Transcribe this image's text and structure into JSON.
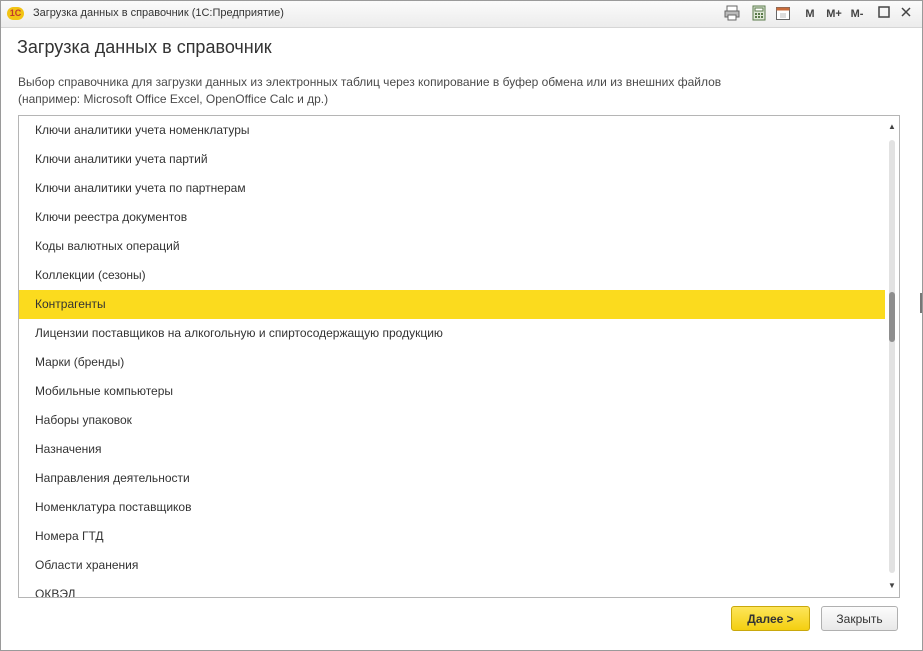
{
  "window": {
    "title": "Загрузка данных в справочник  (1С:Предприятие)",
    "logo": "1С",
    "toolbar": {
      "memory": "M",
      "memory_plus": "M+",
      "memory_minus": "M-"
    }
  },
  "form": {
    "title": "Загрузка данных в справочник",
    "description_line1": "Выбор справочника для загрузки данных из электронных таблиц через копирование в буфер обмена или из внешних файлов",
    "description_line2": "(например: Microsoft Office Excel, OpenOffice Calc и др.)"
  },
  "list": {
    "items": [
      {
        "label": "Ключи аналитики учета номенклатуры",
        "selected": false
      },
      {
        "label": "Ключи аналитики учета партий",
        "selected": false
      },
      {
        "label": "Ключи аналитики учета по партнерам",
        "selected": false
      },
      {
        "label": "Ключи реестра документов",
        "selected": false
      },
      {
        "label": "Коды валютных операций",
        "selected": false
      },
      {
        "label": "Коллекции (сезоны)",
        "selected": false
      },
      {
        "label": "Контрагенты",
        "selected": true
      },
      {
        "label": "Лицензии поставщиков на алкогольную и спиртосодержащую продукцию",
        "selected": false
      },
      {
        "label": "Марки (бренды)",
        "selected": false
      },
      {
        "label": "Мобильные компьютеры",
        "selected": false
      },
      {
        "label": "Наборы упаковок",
        "selected": false
      },
      {
        "label": "Назначения",
        "selected": false
      },
      {
        "label": "Направления деятельности",
        "selected": false
      },
      {
        "label": "Номенклатура поставщиков",
        "selected": false
      },
      {
        "label": "Номера ГТД",
        "selected": false
      },
      {
        "label": "Области хранения",
        "selected": false
      },
      {
        "label": "ОКВЭД",
        "selected": false
      }
    ],
    "selected_color": "#fbdb1e"
  },
  "buttons": {
    "next": "Далее >",
    "close": "Закрыть"
  },
  "colors": {
    "accent": "#f4cf10",
    "text": "#333333"
  }
}
